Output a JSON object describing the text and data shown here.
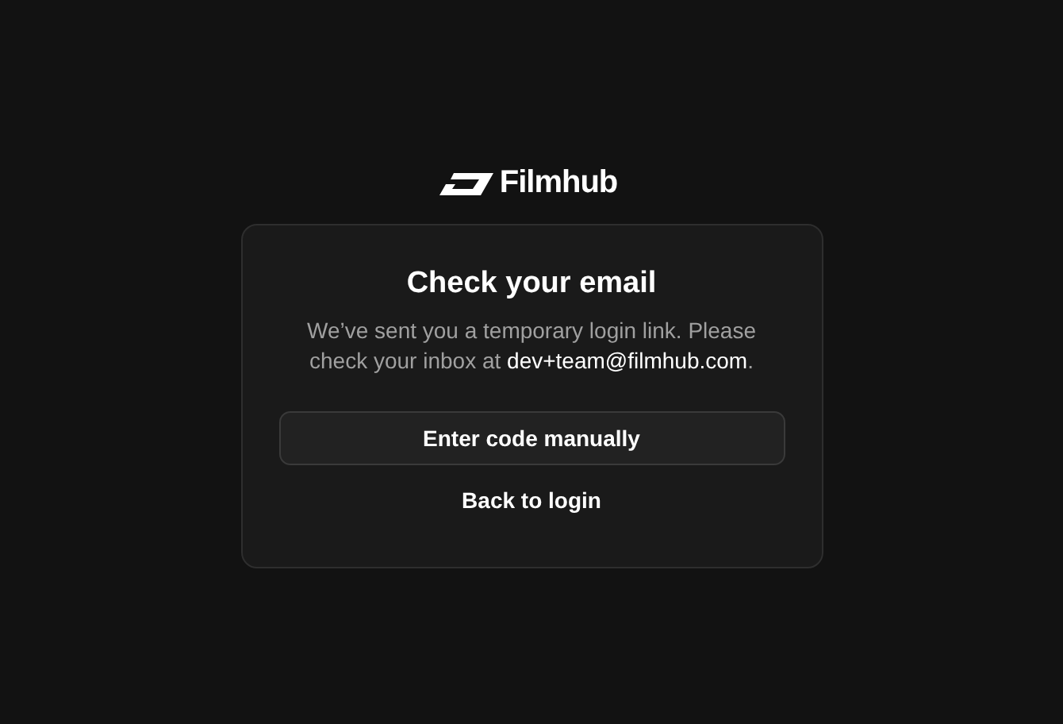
{
  "logo": {
    "name": "Filmhub"
  },
  "card": {
    "title": "Check your email",
    "message": "We’ve sent you a temporary login link. Please check your inbox at **dev+team@filmhub.com**.",
    "buttons": [
      {
        "label": "Enter code manually",
        "kind": "outline"
      },
      {
        "label": "Back to login",
        "kind": "plain"
      }
    ]
  }
}
